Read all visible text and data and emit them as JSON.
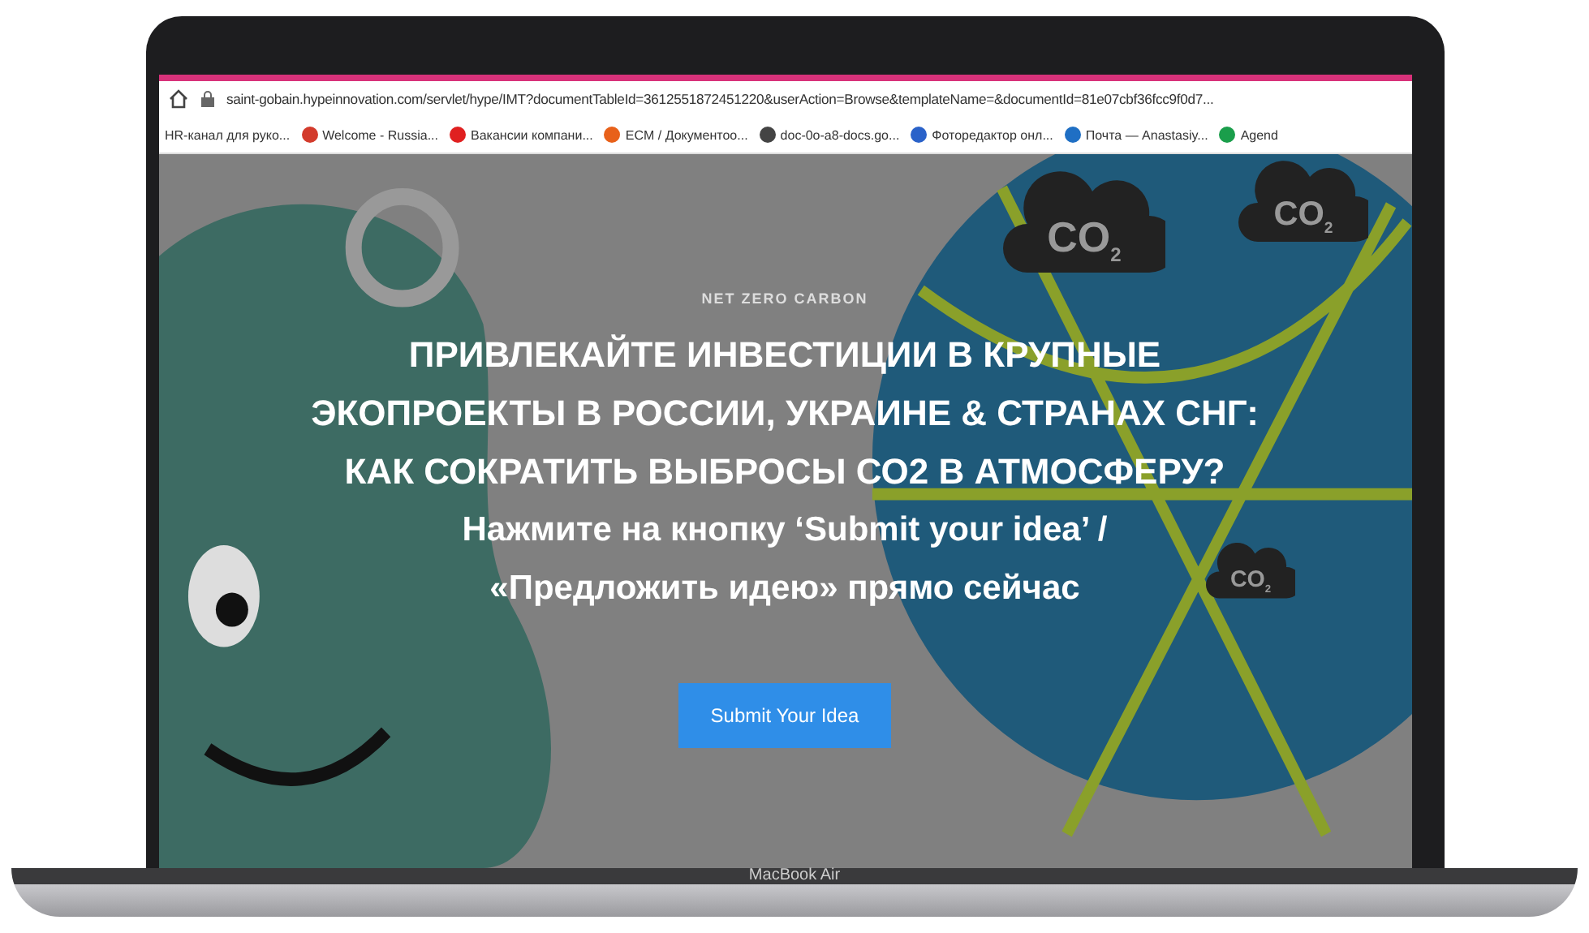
{
  "device": {
    "label": "MacBook Air"
  },
  "browser": {
    "url": "saint-gobain.hypeinnovation.com/servlet/hype/IMT?documentTableId=3612551872451220&userAction=Browse&templateName=&documentId=81e07cbf36fcc9f0d7...",
    "bookmarks": [
      {
        "label": "HR-канал для руко..."
      },
      {
        "label": "Welcome - Russia...",
        "color": "#d33b2c"
      },
      {
        "label": "Вакансии компани...",
        "color": "#e02020"
      },
      {
        "label": "ECM / Документоо...",
        "color": "#e8611a"
      },
      {
        "label": "doc-0o-a8-docs.go...",
        "color": "#444444"
      },
      {
        "label": "Фоторедактор онл...",
        "color": "#2a62c9"
      },
      {
        "label": "Почта — Anastasiy...",
        "color": "#1f6fc4"
      },
      {
        "label": "Agend",
        "color": "#1a9e4b"
      }
    ]
  },
  "hero": {
    "eyebrow": "NET ZERO CARBON",
    "title_lines": [
      "ПРИВЛЕКАЙТЕ ИНВЕСТИЦИИ В КРУПНЫЕ",
      "ЭКОПРОЕКТЫ В РОССИИ, УКРАИНЕ & СТРАНАХ СНГ:",
      "КАК СОКРАТИТЬ ВЫБРОСЫ СО2 В АТМОСФЕРУ?"
    ],
    "subtitle_lines": [
      "Нажмите на кнопку ‘Submit your idea’ /",
      "«Предложить идею» прямо сейчас"
    ],
    "button": "Submit Your Idea",
    "clouds": [
      {
        "label": "CO",
        "sub": "2"
      },
      {
        "label": "CO",
        "sub": "2"
      },
      {
        "label": "CO",
        "sub": "2"
      }
    ]
  }
}
